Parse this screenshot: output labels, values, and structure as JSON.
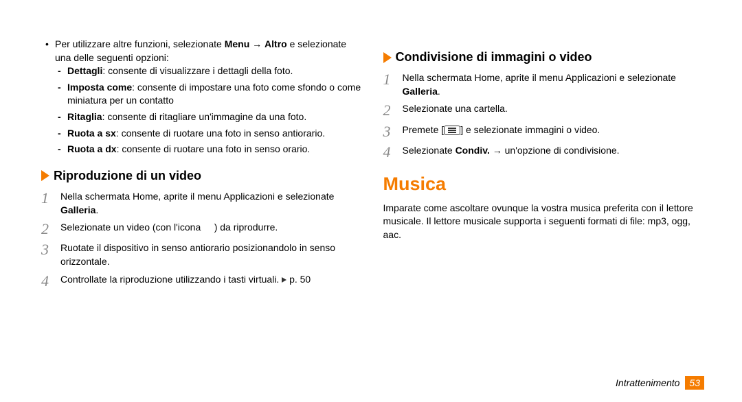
{
  "leftColumn": {
    "topBulletPrefix": "Per utilizzare altre funzioni, selezionate ",
    "topBulletBold1": "Menu",
    "topBulletArrow": " → ",
    "topBulletBold2": "Altro",
    "topBulletSuffix": " e selezionate una delle seguenti opzioni:",
    "dashItems": [
      {
        "bold": "Dettagli",
        "text": ": consente di visualizzare i dettagli della foto."
      },
      {
        "bold": "Imposta come",
        "text": ": consente di impostare una foto come sfondo o come miniatura per un contatto"
      },
      {
        "bold": "Ritaglia",
        "text": ": consente di ritagliare un'immagine da una foto."
      },
      {
        "bold": "Ruota a sx",
        "text": ": consente di ruotare una foto in senso antiorario."
      },
      {
        "bold": "Ruota a dx",
        "text": ": consente di ruotare una foto in senso orario."
      }
    ],
    "subHeading": "Riproduzione di un video",
    "steps": [
      {
        "n": "1",
        "prefix": "Nella schermata Home, aprite il menu Applicazioni e selezionate ",
        "bold": "Galleria",
        "suffix": "."
      },
      {
        "n": "2",
        "prefix": "Selezionate un video (con l'icona ",
        "suffix": ") da riprodurre.",
        "hasGap": true
      },
      {
        "n": "3",
        "text": "Ruotate il dispositivo in senso antiorario posizionandolo in senso orizzontale."
      },
      {
        "n": "4",
        "prefix": "Controllate la riproduzione utilizzando i tasti virtuali. ",
        "pageRef": "p. 50",
        "hasPlay": true
      }
    ]
  },
  "rightColumn": {
    "subHeading": "Condivisione di immagini o video",
    "steps": [
      {
        "n": "1",
        "prefix": "Nella schermata Home, aprite il menu Applicazioni e selezionate ",
        "bold": "Galleria",
        "suffix": "."
      },
      {
        "n": "2",
        "text": "Selezionate una cartella."
      },
      {
        "n": "3",
        "prefix": "Premete [",
        "suffix": "] e selezionate immagini o video.",
        "hasMenuKey": true
      },
      {
        "n": "4",
        "prefix": "Selezionate ",
        "bold": "Condiv.",
        "suffix": " → un'opzione di condivisione."
      }
    ],
    "mainHeading": "Musica",
    "paragraph": "Imparate come ascoltare ovunque la vostra musica preferita con il lettore musicale. Il lettore musicale supporta i seguenti formati di file: mp3, ogg, aac."
  },
  "footer": {
    "section": "Intrattenimento",
    "page": "53"
  }
}
